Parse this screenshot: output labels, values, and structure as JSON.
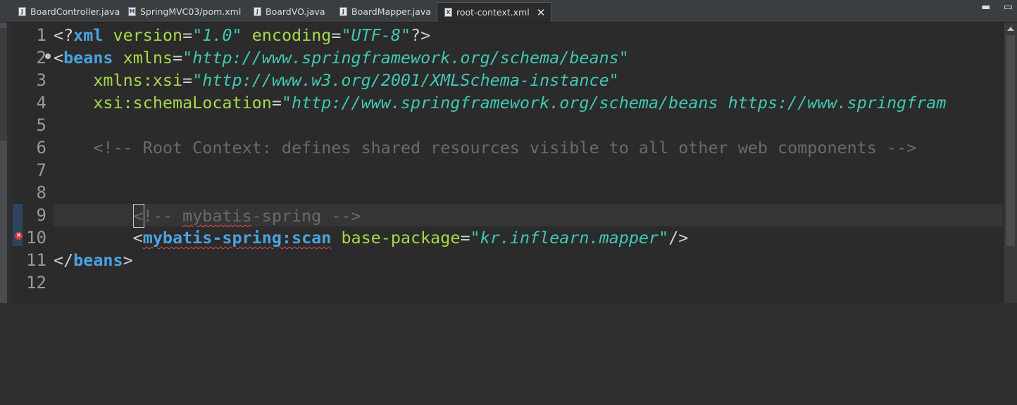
{
  "tabs": [
    {
      "label": "BoardController.java",
      "icon": "java-file-icon",
      "icon_glyph": "J"
    },
    {
      "label": "SpringMVC03/pom.xml",
      "icon": "maven-file-icon",
      "icon_glyph": "M"
    },
    {
      "label": "BoardVO.java",
      "icon": "java-file-icon",
      "icon_glyph": "J"
    },
    {
      "label": "BoardMapper.java",
      "icon": "java-file-icon",
      "icon_glyph": "J"
    },
    {
      "label": "root-context.xml",
      "icon": "xml-file-icon",
      "icon_glyph": "X",
      "active": true,
      "close": "✕"
    }
  ],
  "window_buttons": {
    "minimize": "▬",
    "maximize": "▭"
  },
  "line_numbers": [
    "1",
    "2",
    "3",
    "4",
    "5",
    "6",
    "7",
    "8",
    "9",
    "10",
    "11",
    "12"
  ],
  "code": {
    "l1": {
      "open": "<?",
      "tag": "xml",
      "a1": "version",
      "eq1": "=",
      "v1": "\"1.0\"",
      "a2": "encoding",
      "eq2": "=",
      "v2": "\"UTF-8\"",
      "close": "?>"
    },
    "l2": {
      "open": "<",
      "tag": "beans",
      "a1": "xmlns",
      "eq": "=",
      "v1": "\"http://www.springframework.org/schema/beans\""
    },
    "l3": {
      "attr": "xmlns:xsi",
      "eq": "=",
      "val": "\"http://www.w3.org/2001/XMLSchema-instance\""
    },
    "l4": {
      "attr": "xsi:schemaLocation",
      "eq": "=",
      "val": "\"http://www.springframework.org/schema/beans https://www.springfram"
    },
    "l6": {
      "comment": "<!-- Root Context: defines shared resources visible to all other web components -->"
    },
    "l9": {
      "caret_char": "<",
      "rest_a": "!-- ",
      "underlined": "mybatis",
      "rest_b": "-spring -->"
    },
    "l10": {
      "open": "<",
      "tag": "mybatis-spring:scan",
      "attr": "base-package",
      "eq": "=",
      "val": "\"kr.inflearn.mapper\"",
      "close": "/>"
    },
    "l11": {
      "open": "</",
      "tag": "beans",
      "close": ">"
    }
  }
}
